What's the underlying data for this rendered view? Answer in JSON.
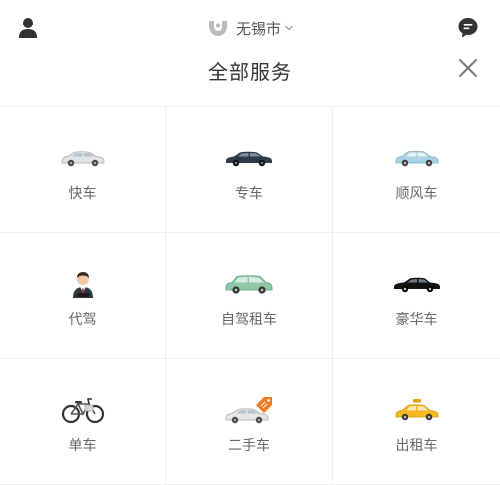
{
  "header": {
    "city": "无锡市",
    "title": "全部服务"
  },
  "icons": {
    "user": "person-icon",
    "chat": "message-icon",
    "logo": "didi-logo-icon",
    "close": "close-icon",
    "city_dropdown": "chevron-down-icon"
  },
  "services": [
    {
      "label": "快车",
      "icon": "silver-sedan-icon"
    },
    {
      "label": "专车",
      "icon": "dark-sedan-icon"
    },
    {
      "label": "顺风车",
      "icon": "light-blue-car-icon"
    },
    {
      "label": "代驾",
      "icon": "driver-person-icon"
    },
    {
      "label": "自驾租车",
      "icon": "green-suv-icon"
    },
    {
      "label": "豪华车",
      "icon": "black-luxury-car-icon"
    },
    {
      "label": "单车",
      "icon": "bicycle-icon"
    },
    {
      "label": "二手车",
      "icon": "car-with-tag-icon"
    },
    {
      "label": "出租车",
      "icon": "yellow-taxi-icon"
    }
  ],
  "colors": {
    "divider": "#eeeeee",
    "label": "#666666",
    "icon_dark": "#333333",
    "accent_orange": "#f47c20",
    "taxi_yellow": "#f5b820"
  }
}
